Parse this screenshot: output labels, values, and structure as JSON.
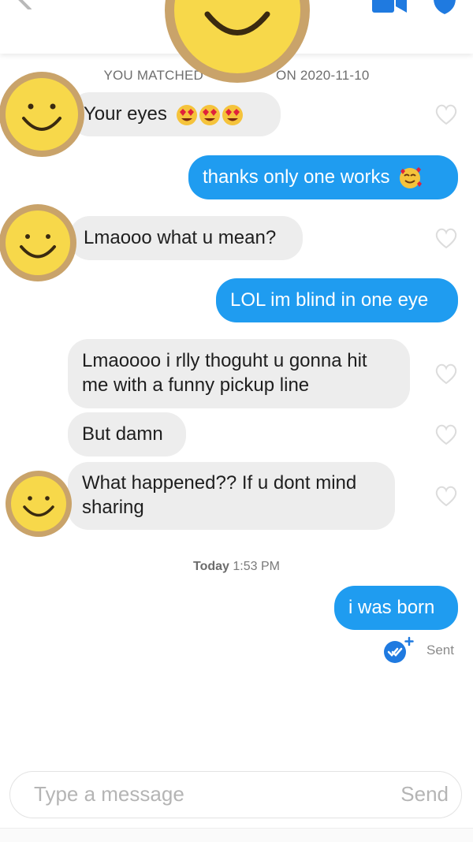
{
  "header": {
    "match_prefix": "YOU MATCHED",
    "match_suffix": "ON 2020-11-10"
  },
  "messages": [
    {
      "id": 1,
      "direction": "incoming",
      "text": "Your eyes",
      "emoji": [
        "heart-eyes",
        "heart-eyes",
        "heart-eyes"
      ]
    },
    {
      "id": 2,
      "direction": "outgoing",
      "text": "thanks only one works",
      "emoji": [
        "smiling-face-with-hearts"
      ]
    },
    {
      "id": 3,
      "direction": "incoming",
      "text": "Lmaooo what u mean?"
    },
    {
      "id": 4,
      "direction": "outgoing",
      "text": "LOL im blind in one eye"
    },
    {
      "id": 5,
      "direction": "incoming",
      "text": "Lmaoooo i rlly thoguht u gonna hit me with a funny pickup line"
    },
    {
      "id": 6,
      "direction": "incoming",
      "text": "But damn"
    },
    {
      "id": 7,
      "direction": "incoming",
      "text": "What happened?? If u dont mind sharing"
    },
    {
      "id": 8,
      "direction": "outgoing",
      "text": "i was born"
    }
  ],
  "timestamp": {
    "day": "Today",
    "time": "1:53 PM"
  },
  "status": {
    "sent_label": "Sent"
  },
  "composer": {
    "placeholder": "Type a message",
    "send_label": "Send"
  },
  "colors": {
    "outgoing_bubble": "#1f9cf0",
    "incoming_bubble": "#ededed",
    "accent_blue": "#1f7ae0",
    "avatar_yellow": "#f7d84a",
    "avatar_ring": "#c9a36a"
  },
  "icons": [
    "back-chevron-icon",
    "video-call-icon",
    "shield-icon",
    "heart-icon",
    "read-receipt-icon"
  ]
}
